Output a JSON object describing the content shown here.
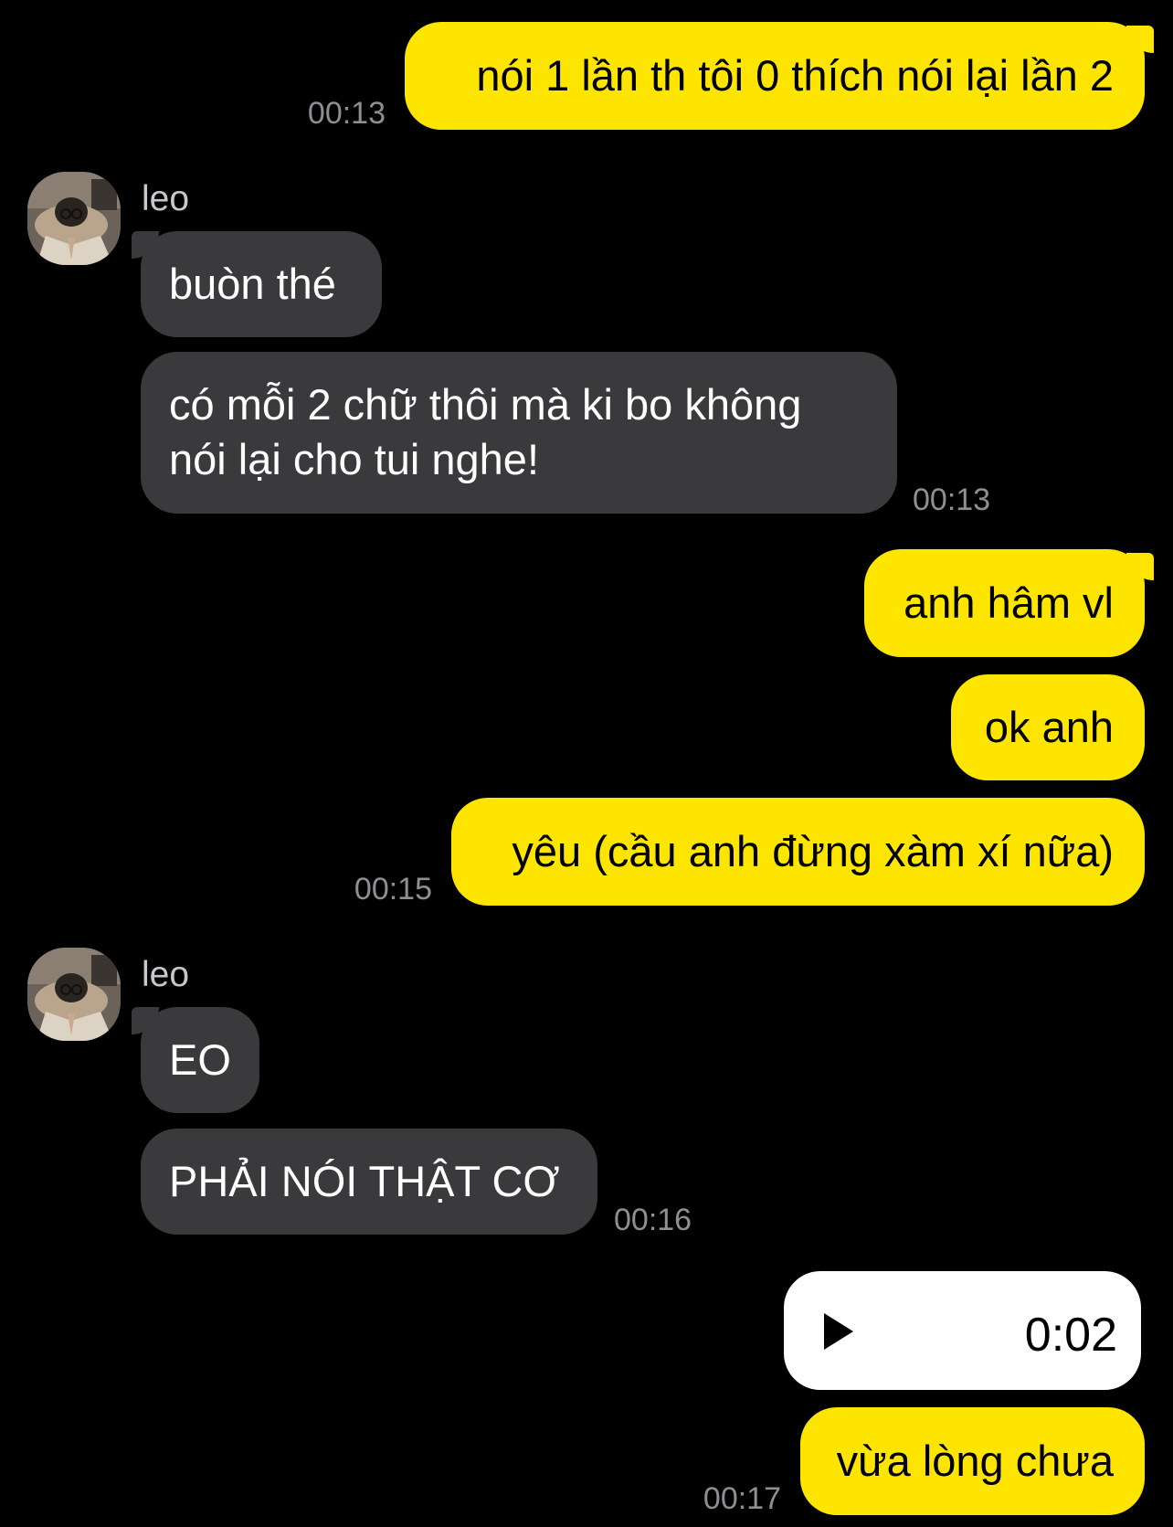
{
  "contact": {
    "name": "leo"
  },
  "messages": [
    {
      "text": "nói 1 lần th tôi 0 thích nói lại lần 2",
      "time": "00:13"
    },
    {
      "text": "buòn thé"
    },
    {
      "text": "có mỗi 2 chữ thôi mà ki bo không nói lại cho tui nghe!",
      "time": "00:13"
    },
    {
      "text": "anh hâm vl"
    },
    {
      "text": "ok anh"
    },
    {
      "text": "yêu (cầu anh đừng xàm xí nữa)",
      "time": "00:15"
    },
    {
      "text": "EO"
    },
    {
      "text": "PHẢI NÓI THẬT CƠ",
      "time": "00:16"
    },
    {
      "voice_duration": "0:02"
    },
    {
      "text": "vừa lòng chưa",
      "time": "00:17"
    }
  ],
  "colors": {
    "background": "#000000",
    "outgoing_bubble": "#FEE500",
    "incoming_bubble": "#3A3A3C",
    "voice_bubble": "#FFFFFF",
    "timestamp": "#8E8E93"
  },
  "icons": {
    "avatar": "avatar-photo",
    "voice_play": "play-icon"
  }
}
